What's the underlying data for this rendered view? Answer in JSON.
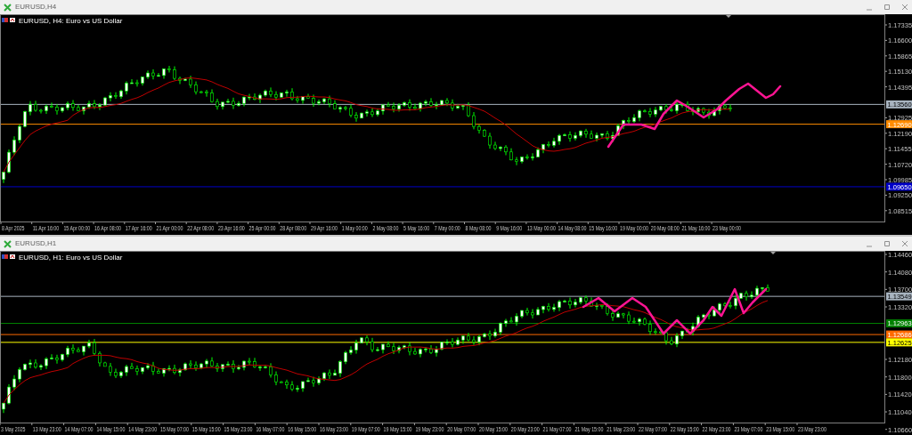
{
  "windows": [
    {
      "title": "EURUSD,H4",
      "chart_label": "EURUSD, H4: Euro vs US Dollar",
      "price_ticks": [
        "1.17335",
        "1.16600",
        "1.15865",
        "1.15130",
        "1.14395",
        "1.12925",
        "1.12190",
        "1.11455",
        "1.10720",
        "1.09985",
        "1.09250",
        "1.08515"
      ],
      "price_tags": [
        {
          "text": "1.13560",
          "color": "#a8b4c0"
        },
        {
          "text": "1.12690",
          "color": "#ff8c00"
        },
        {
          "text": "1.09650",
          "color": "#0000c8"
        }
      ],
      "time_labels": [
        "8 Apr 2025",
        "11 Apr 16:00",
        "15 Apr 00:00",
        "16 Apr 08:00",
        "17 Apr 16:00",
        "21 Apr 00:00",
        "22 Apr 08:00",
        "23 Apr 16:00",
        "25 Apr 00:00",
        "28 Apr 08:00",
        "29 Apr 16:00",
        "1 May 00:00",
        "2 May 08:00",
        "5 May 16:00",
        "7 May 00:00",
        "8 May 08:00",
        "9 May 16:00",
        "13 May 00:00",
        "14 May 08:00",
        "15 May 16:00",
        "19 May 00:00",
        "20 May 08:00",
        "21 May 16:00",
        "23 May 00:00"
      ]
    },
    {
      "title": "EURUSD,H1",
      "chart_label": "EURUSD, H1: Euro vs US Dollar",
      "price_ticks": [
        "1.14460",
        "1.14080",
        "1.13700",
        "1.13320",
        "1.12180",
        "1.11800",
        "1.11420",
        "1.11040",
        "1.10660"
      ],
      "price_tags": [
        {
          "text": "1.13549",
          "color": "#a8b4c0"
        },
        {
          "text": "1.12963",
          "color": "#008000"
        },
        {
          "text": "1.12686",
          "color": "#ff6a00"
        },
        {
          "text": "1.12625",
          "color": "#ffff00"
        }
      ],
      "time_labels": [
        "3 May 2025",
        "13 May 23:00",
        "14 May 07:00",
        "14 May 15:00",
        "14 May 23:00",
        "15 May 07:00",
        "15 May 15:00",
        "15 May 23:00",
        "16 May 07:00",
        "16 May 15:00",
        "16 May 23:00",
        "19 May 07:00",
        "19 May 15:00",
        "19 May 23:00",
        "20 May 07:00",
        "20 May 15:00",
        "20 May 23:00",
        "21 May 07:00",
        "21 May 15:00",
        "21 May 23:00",
        "22 May 07:00",
        "22 May 15:00",
        "22 May 23:00",
        "23 May 07:00",
        "23 May 15:00",
        "23 May 23:00"
      ]
    }
  ]
}
